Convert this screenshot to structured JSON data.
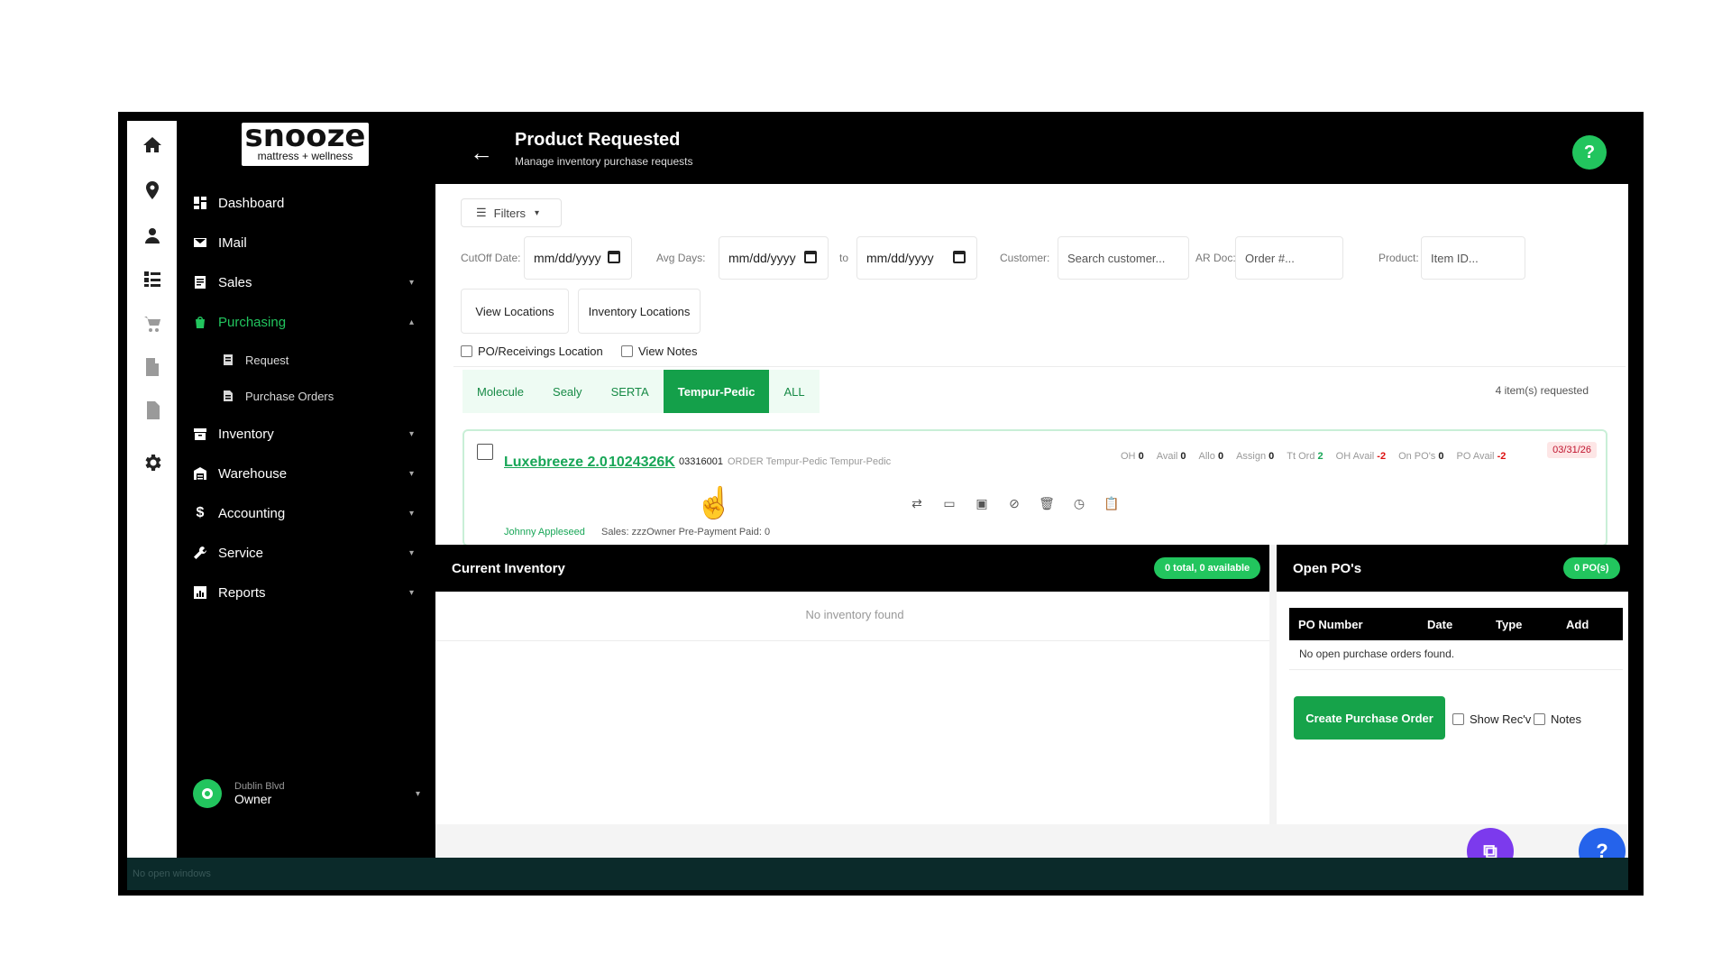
{
  "brand": {
    "logo_top": "snooze",
    "logo_bottom": "mattress + wellness"
  },
  "rail_icons": [
    "home-icon",
    "location-pin-icon",
    "user-icon",
    "checklist-icon",
    "cart-icon",
    "building-icon",
    "document-icon",
    "gear-icon"
  ],
  "sidebar": {
    "items": [
      {
        "label": "Dashboard",
        "icon": "dashboard-icon"
      },
      {
        "label": "IMail",
        "icon": "mail-icon"
      },
      {
        "label": "Sales",
        "icon": "sales-icon"
      },
      {
        "label": "Purchasing",
        "icon": "bag-icon"
      },
      {
        "label": "Inventory",
        "icon": "inventory-icon"
      },
      {
        "label": "Warehouse",
        "icon": "warehouse-icon"
      },
      {
        "label": "Accounting",
        "icon": "dollar-icon"
      },
      {
        "label": "Service",
        "icon": "wrench-icon"
      },
      {
        "label": "Reports",
        "icon": "reports-icon"
      }
    ],
    "sub_items": [
      {
        "label": "Request"
      },
      {
        "label": "Purchase Orders"
      }
    ],
    "user": {
      "location": "Dublin Blvd",
      "role": "Owner"
    }
  },
  "header": {
    "title": "Product Requested",
    "subtitle": "Manage inventory purchase requests",
    "help": "?"
  },
  "filters": {
    "button": "Filters",
    "cutoff_label": "CutOff Date:",
    "cutoff_value": "mm/dd/yyyy",
    "avg_label": "Avg Days:",
    "avg_from": "mm/dd/yyyy",
    "to_label": "to",
    "avg_to": "mm/dd/yyyy",
    "customer_label": "Customer:",
    "customer_placeholder": "Search customer...",
    "ar_label": "AR Doc:",
    "ar_placeholder": "Order #...",
    "product_label": "Product:",
    "product_placeholder": "Item ID..."
  },
  "location_buttons": {
    "view": "View Locations",
    "inventory": "Inventory Locations"
  },
  "checks": {
    "po_receivings": "PO/Receivings Location",
    "view_notes": "View Notes"
  },
  "tabs": [
    "Molecule",
    "Sealy",
    "SERTA",
    "Tempur-Pedic",
    "ALL"
  ],
  "active_tab": "Tempur-Pedic",
  "item_count": "4 item(s) requested",
  "request": {
    "name": "Luxebreeze 2.0",
    "item_id": "1024326K",
    "code": "03316001",
    "meta": "ORDER  Tempur-Pedic  Tempur-Pedic",
    "stats": [
      {
        "label": "OH",
        "value": "0",
        "tone": "normal"
      },
      {
        "label": "Avail",
        "value": "0",
        "tone": "normal"
      },
      {
        "label": "Allo",
        "value": "0",
        "tone": "normal"
      },
      {
        "label": "Assign",
        "value": "0",
        "tone": "normal"
      },
      {
        "label": "Tt Ord",
        "value": "2",
        "tone": "pos"
      },
      {
        "label": "OH Avail",
        "value": "-2",
        "tone": "neg"
      },
      {
        "label": "On PO's",
        "value": "0",
        "tone": "normal"
      },
      {
        "label": "PO Avail",
        "value": "-2",
        "tone": "neg"
      }
    ],
    "date": "03/31/26",
    "customer": "Johnny Appleseed",
    "customer_meta": "Sales: zzzOwner   Pre-Payment   Paid: 0",
    "actions": [
      "swap-icon",
      "play-icon",
      "image-icon",
      "cancel-icon",
      "trash-icon",
      "clock-icon",
      "clipboard-icon"
    ]
  },
  "inventory_panel": {
    "title": "Current Inventory",
    "badge": "0 total, 0 available",
    "empty": "No inventory found"
  },
  "po_panel": {
    "title": "Open PO's",
    "badge": "0 PO(s)",
    "columns": [
      "PO Number",
      "Date",
      "Type",
      "Add"
    ],
    "empty": "No open purchase orders found.",
    "create_button": "Create Purchase Order",
    "show_recv": "Show Rec'v",
    "notes": "Notes"
  },
  "status_bar": "No open windows",
  "colors": {
    "accent": "#22c55e",
    "accent_dark": "#14a04a",
    "fab_purple": "#7c3aed",
    "fab_blue": "#2563eb"
  }
}
